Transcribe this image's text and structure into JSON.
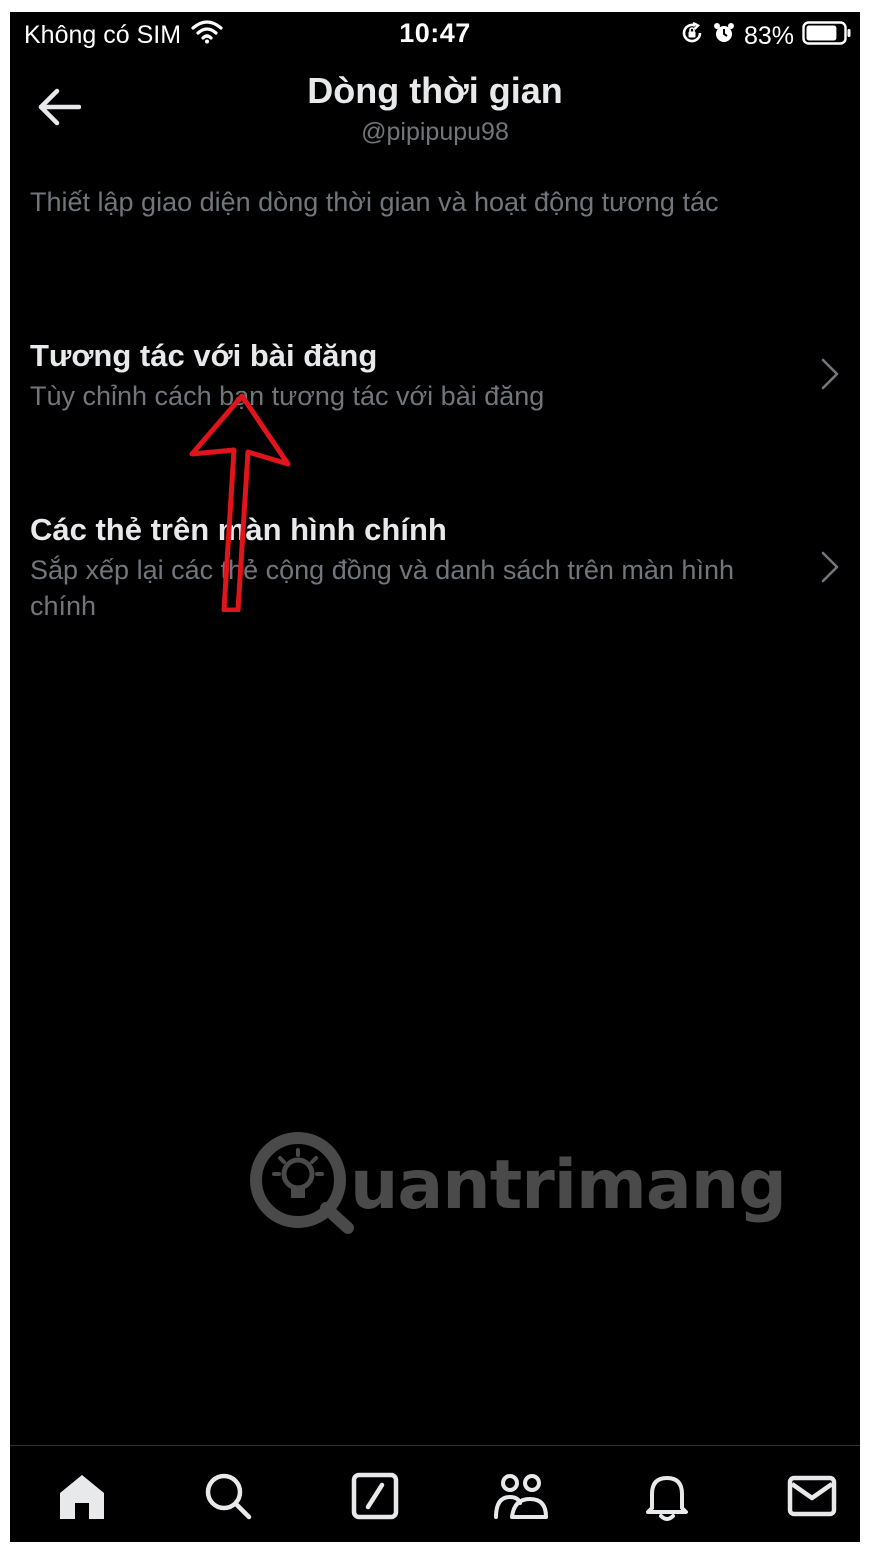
{
  "status_bar": {
    "carrier": "Không có SIM",
    "time": "10:47",
    "battery_percent": "83%",
    "battery_level": 0.83,
    "icons": [
      "wifi-icon",
      "orientation-lock-icon",
      "alarm-icon",
      "battery-icon"
    ]
  },
  "header": {
    "back_icon": "arrow-left-icon",
    "title": "Dòng thời gian",
    "subtitle": "@pipipupu98"
  },
  "section": {
    "description": "Thiết lập giao diện dòng thời gian và hoạt động tương tác"
  },
  "settings": [
    {
      "title": "Tương tác với bài đăng",
      "description": "Tùy chỉnh cách bạn tương tác với bài đăng",
      "icon": "chevron-right-icon"
    },
    {
      "title": "Các thẻ trên màn hình chính",
      "description": "Sắp xếp lại các thẻ cộng đồng và danh sách trên màn hình chính",
      "icon": "chevron-right-icon"
    }
  ],
  "annotation": {
    "type": "red-arrow",
    "color": "#e0151b"
  },
  "watermark": {
    "text": "uantrimang",
    "logo": "quantrimang-logo"
  },
  "tab_bar": {
    "tabs": [
      "home-icon",
      "search-icon",
      "grok-icon",
      "communities-icon",
      "notifications-icon",
      "messages-icon"
    ],
    "active": "home-icon"
  },
  "colors": {
    "background": "#000000",
    "primary_text": "#e7e9ea",
    "secondary_text": "#71767b",
    "divider": "#2f3336"
  }
}
